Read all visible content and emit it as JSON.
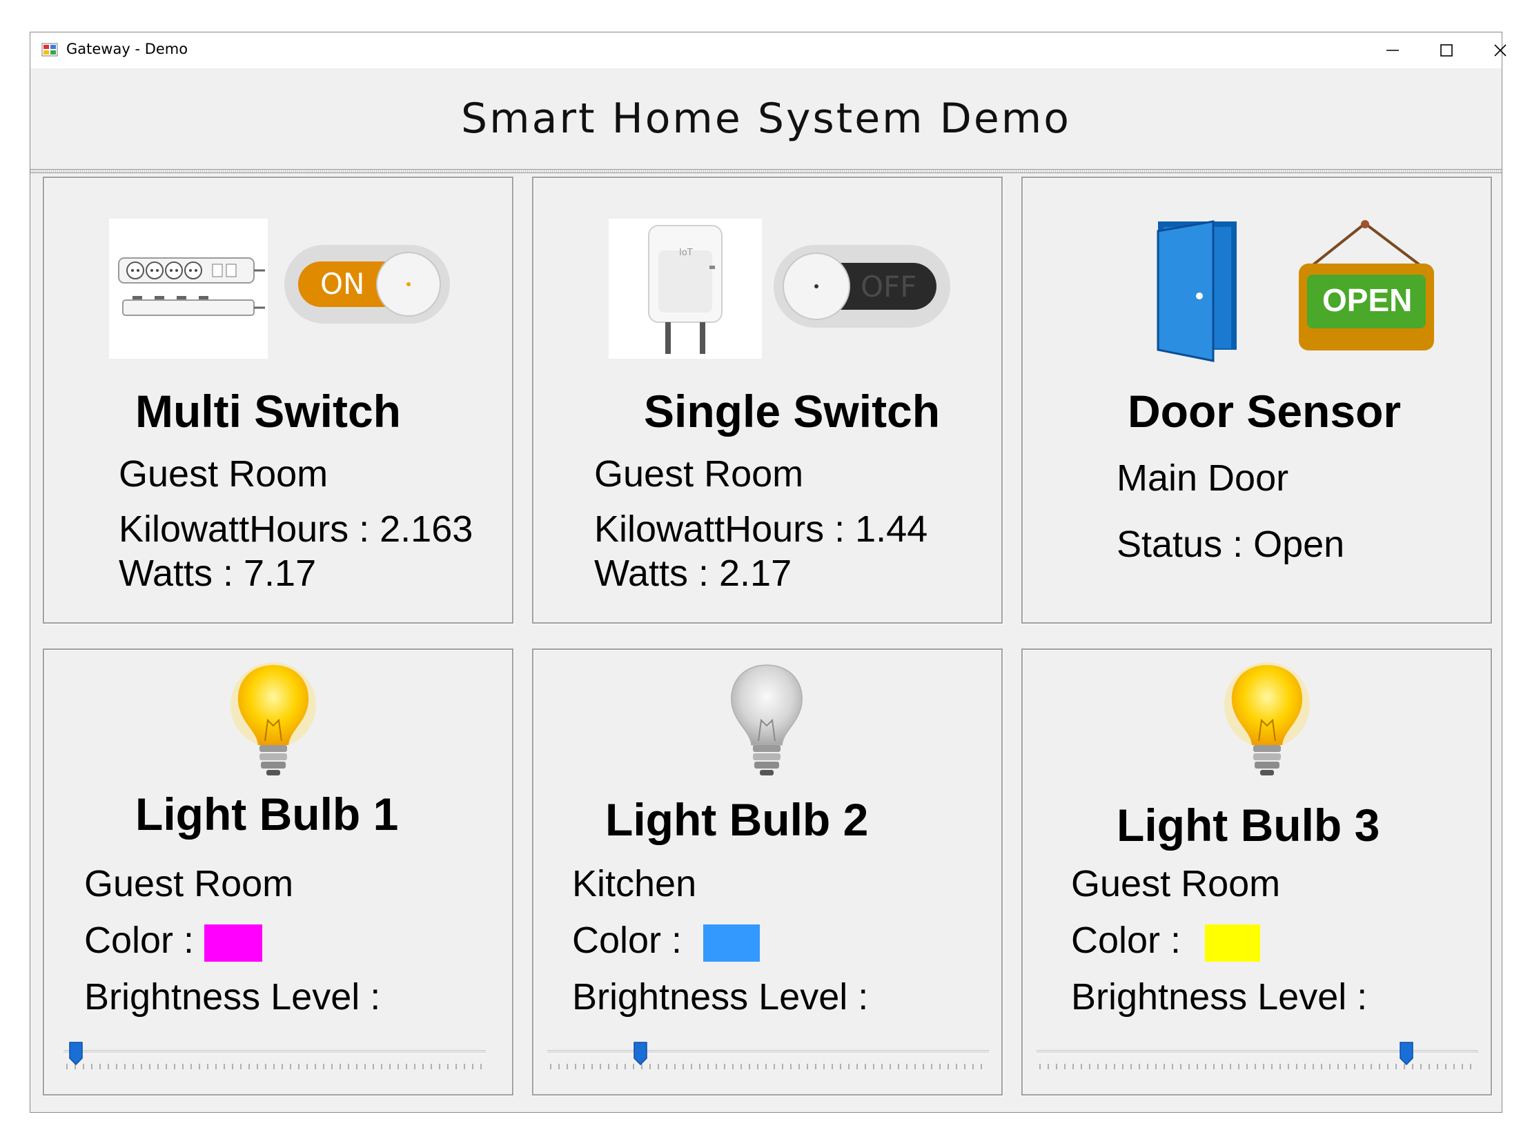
{
  "window": {
    "title": "Gateway - Demo"
  },
  "header": {
    "title": "Smart Home System Demo"
  },
  "devices": {
    "multi_switch": {
      "name": "Multi Switch",
      "room": "Guest Room",
      "kwh": "KilowattHours : 2.163",
      "watts": "Watts : 7.17",
      "toggle_label": "ON",
      "state": "on"
    },
    "single_switch": {
      "name": "Single Switch",
      "room": "Guest Room",
      "kwh": "KilowattHours : 1.44",
      "watts": "Watts : 2.17",
      "toggle_label": "OFF",
      "state": "off"
    },
    "door_sensor": {
      "name": "Door Sensor",
      "location": "Main Door",
      "status": "Status : Open",
      "sign_label": "OPEN",
      "plug_badge": "IoT"
    },
    "bulb1": {
      "name": "Light Bulb 1",
      "room": "Guest Room",
      "color_label": "Color :",
      "color": "#ff00ff",
      "brightness_label": "Brightness Level :",
      "brightness": 0.01,
      "lit": true
    },
    "bulb2": {
      "name": "Light Bulb 2",
      "room": "Kitchen",
      "color_label": "Color :",
      "color": "#3399ff",
      "brightness_label": "Brightness Level :",
      "brightness": 0.2,
      "lit": false
    },
    "bulb3": {
      "name": "Light Bulb 3",
      "room": "Guest Room",
      "color_label": "Color :",
      "color": "#ffff00",
      "brightness_label": "Brightness Level :",
      "brightness": 0.85,
      "lit": true
    }
  }
}
